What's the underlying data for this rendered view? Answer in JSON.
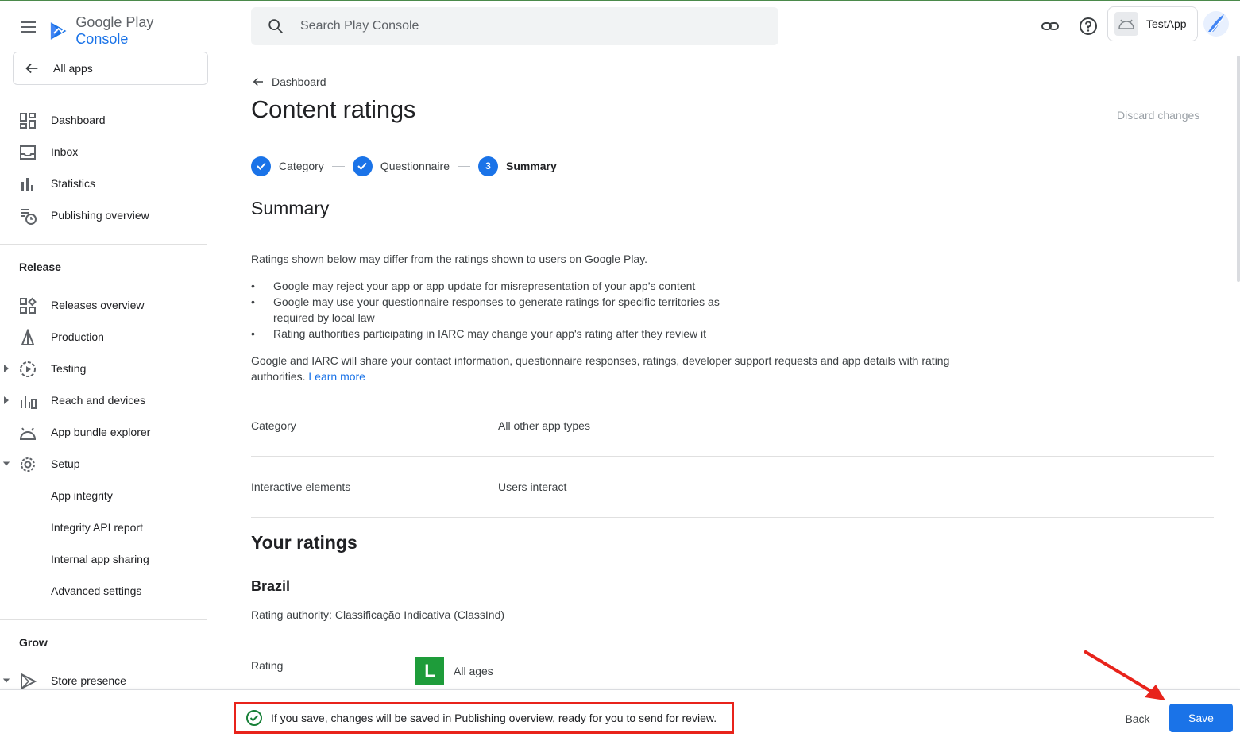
{
  "brand": {
    "name_prefix": "Google Play",
    "name_accent": "Console",
    "accent_color": "#1a73e8"
  },
  "sidebar": {
    "all_apps_label": "All apps",
    "top_items": [
      {
        "label": "Dashboard",
        "icon": "dashboard-icon"
      },
      {
        "label": "Inbox",
        "icon": "inbox-icon"
      },
      {
        "label": "Statistics",
        "icon": "bar-chart-icon"
      },
      {
        "label": "Publishing overview",
        "icon": "publishing-overview-icon"
      }
    ],
    "release_heading": "Release",
    "release_items": [
      {
        "label": "Releases overview",
        "icon": "releases-overview-icon"
      },
      {
        "label": "Production",
        "icon": "production-icon"
      },
      {
        "label": "Testing",
        "icon": "testing-icon"
      },
      {
        "label": "Reach and devices",
        "icon": "reach-devices-icon"
      },
      {
        "label": "App bundle explorer",
        "icon": "android-icon"
      },
      {
        "label": "Setup",
        "icon": "gear-icon"
      },
      {
        "label": "App integrity"
      },
      {
        "label": "Integrity API report"
      },
      {
        "label": "Internal app sharing"
      },
      {
        "label": "Advanced settings"
      }
    ],
    "grow_heading": "Grow",
    "grow_items": [
      {
        "label": "Store presence",
        "icon": "play-store-icon"
      }
    ]
  },
  "header": {
    "search_placeholder": "Search Play Console",
    "app_name": "TestApp"
  },
  "main": {
    "breadcrumb": "Dashboard",
    "title": "Content ratings",
    "discard_label": "Discard changes",
    "steps": [
      {
        "label": "Category",
        "state": "done"
      },
      {
        "label": "Questionnaire",
        "state": "done"
      },
      {
        "label": "Summary",
        "state": "active",
        "number": "3"
      }
    ],
    "summary_heading": "Summary",
    "intro": "Ratings shown below may differ from the ratings shown to users on Google Play.",
    "bullets": [
      "Google may reject your app or app update for misrepresentation of your app’s content",
      "Google may use your questionnaire responses to generate ratings for specific territories as required by local law",
      "Rating authorities participating in IARC may change your app's rating after they review it"
    ],
    "share_text": "Google and IARC will share your contact information, questionnaire responses, ratings, developer support requests and app details with rating authorities.",
    "learn_more": "Learn more",
    "category_label": "Category",
    "category_value": "All other app types",
    "interactive_label": "Interactive elements",
    "interactive_value": "Users interact",
    "ratings_heading": "Your ratings",
    "country": "Brazil",
    "authority": "Rating authority: Classificação Indicativa (ClassInd)",
    "rating_label": "Rating",
    "rating_badge": "L",
    "rating_value": "All ages"
  },
  "footer": {
    "notice": "If you save, changes will be saved in Publishing overview, ready for you to send for review.",
    "back_label": "Back",
    "save_label": "Save"
  }
}
